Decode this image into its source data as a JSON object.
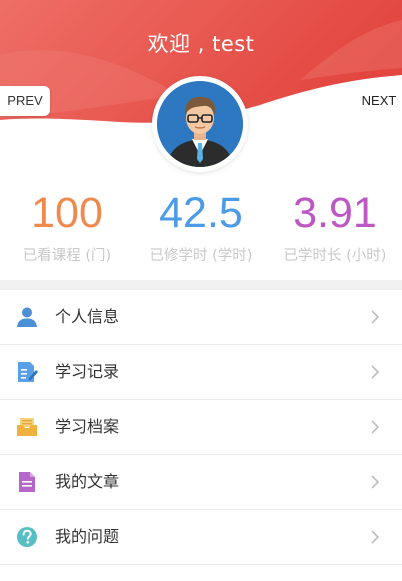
{
  "header": {
    "welcome": "欢迎 , test",
    "prev_label": "PREV",
    "next_label": "NEXT"
  },
  "colors": {
    "header_red": "#e85a52",
    "courses": "#ee8a4e",
    "study_hours": "#4b9be6",
    "study_duration": "#bd57c4"
  },
  "stats": [
    {
      "value": "100",
      "label": "已看课程 (门)"
    },
    {
      "value": "42.5",
      "label": "已修学时 (学时)"
    },
    {
      "value": "3.91",
      "label": "已学时长 (小时)"
    }
  ],
  "menu": [
    {
      "label": "个人信息",
      "icon": "person-icon"
    },
    {
      "label": "学习记录",
      "icon": "study-record-icon"
    },
    {
      "label": "学习档案",
      "icon": "archive-tray-icon"
    },
    {
      "label": "我的文章",
      "icon": "document-icon"
    },
    {
      "label": "我的问题",
      "icon": "question-icon"
    }
  ]
}
